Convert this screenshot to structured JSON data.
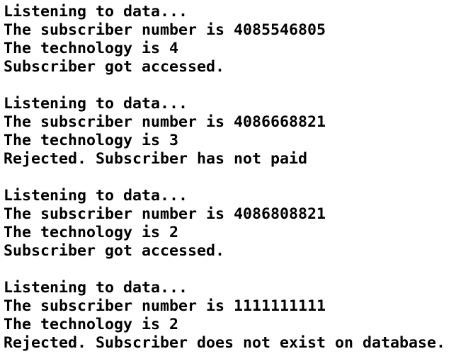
{
  "output": [
    {
      "listening": "Listening to data...",
      "subscriber": "The subscriber number is 4085546805",
      "technology": "The technology is 4",
      "result": "Subscriber got accessed."
    },
    {
      "listening": "Listening to data...",
      "subscriber": "The subscriber number is 4086668821",
      "technology": "The technology is 3",
      "result": "Rejected. Subscriber has not paid"
    },
    {
      "listening": "Listening to data...",
      "subscriber": "The subscriber number is 4086808821",
      "technology": "The technology is 2",
      "result": "Subscriber got accessed."
    },
    {
      "listening": "Listening to data...",
      "subscriber": "The subscriber number is 1111111111",
      "technology": "The technology is 2",
      "result": "Rejected. Subscriber does not exist on database."
    }
  ]
}
